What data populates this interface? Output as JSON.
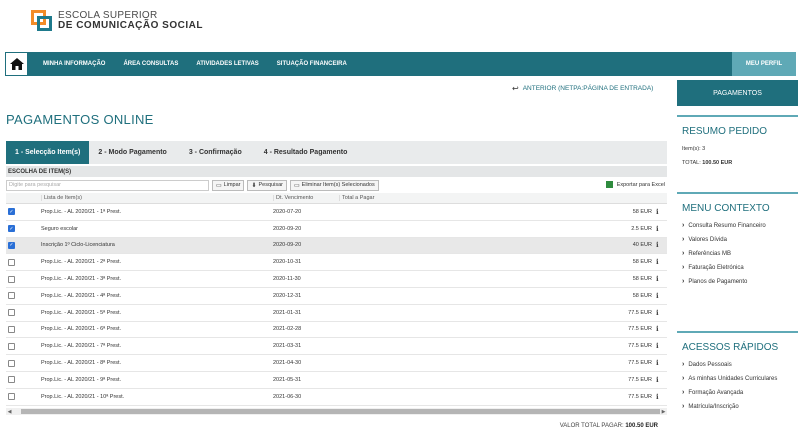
{
  "logo": {
    "line1": "ESCOLA SUPERIOR",
    "line2": "COMUNICAÇÃO SOCIAL",
    "line2_prefix": "DE"
  },
  "nav": {
    "items": [
      "MINHA INFORMAÇÃO",
      "ÁREA CONSULTAS",
      "ATIVIDADES LETIVAS",
      "SITUAÇÃO FINANCEIRA"
    ],
    "profile": "MEU PERFIL"
  },
  "anterior": "ANTERIOR (NETPA:PÁGINA DE ENTRADA)",
  "page_title": "PAGAMENTOS ONLINE",
  "steps": [
    "1 - Selecção Item(s)",
    "2 - Modo Pagamento",
    "3 - Confirmação",
    "4 - Resultado Pagamento"
  ],
  "section_title": "ESCOLHA DE ITEM(S)",
  "toolbar": {
    "search_placeholder": "Digite para pesquisar",
    "clear": "Limpar",
    "search": "Pesquisar",
    "remove": "Eliminar Item(s) Selecionados",
    "export": "Exportar para Excel"
  },
  "table": {
    "headers": {
      "desc": "Lista de Item(s)",
      "date": "Dt. Vencimento",
      "total": "Total a Pagar"
    },
    "rows": [
      {
        "checked": true,
        "desc": "Prop.Lic. - AL 2020/21 - 1ª Prest.",
        "date": "2020-07-20",
        "total": "58 EUR"
      },
      {
        "checked": true,
        "desc": "Seguro escolar",
        "date": "2020-09-20",
        "total": "2.5 EUR"
      },
      {
        "checked": true,
        "desc": "Inscrição 1º Ciclo-Licenciatura",
        "date": "2020-09-20",
        "total": "40 EUR"
      },
      {
        "checked": false,
        "desc": "Prop.Lic. - AL 2020/21 - 2ª Prest.",
        "date": "2020-10-31",
        "total": "58 EUR"
      },
      {
        "checked": false,
        "desc": "Prop.Lic. - AL 2020/21 - 3ª Prest.",
        "date": "2020-11-30",
        "total": "58 EUR"
      },
      {
        "checked": false,
        "desc": "Prop.Lic. - AL 2020/21 - 4ª Prest.",
        "date": "2020-12-31",
        "total": "58 EUR"
      },
      {
        "checked": false,
        "desc": "Prop.Lic. - AL 2020/21 - 5ª Prest.",
        "date": "2021-01-31",
        "total": "77.5 EUR"
      },
      {
        "checked": false,
        "desc": "Prop.Lic. - AL 2020/21 - 6ª Prest.",
        "date": "2021-02-28",
        "total": "77.5 EUR"
      },
      {
        "checked": false,
        "desc": "Prop.Lic. - AL 2020/21 - 7ª Prest.",
        "date": "2021-03-31",
        "total": "77.5 EUR"
      },
      {
        "checked": false,
        "desc": "Prop.Lic. - AL 2020/21 - 8ª Prest.",
        "date": "2021-04-30",
        "total": "77.5 EUR"
      },
      {
        "checked": false,
        "desc": "Prop.Lic. - AL 2020/21 - 9ª Prest.",
        "date": "2021-05-31",
        "total": "77.5 EUR"
      },
      {
        "checked": false,
        "desc": "Prop.Lic. - AL 2020/21 - 10ª Prest.",
        "date": "2021-06-30",
        "total": "77.5 EUR"
      }
    ]
  },
  "total_label": "VALOR TOTAL PAGAR:",
  "total_value": "100.50 EUR",
  "sidebar": {
    "payments_button": "PAGAMENTOS",
    "summary_title": "RESUMO PEDIDO",
    "items_label": "Item(s): 3",
    "total_label": "TOTAL:",
    "total_value": "100.50 EUR",
    "context_title": "MENU CONTEXTO",
    "context_links": [
      "Consulta Resumo Financeiro",
      "Valores Dívida",
      "Referências MB",
      "Faturação Eletrónica",
      "Planos de Pagamento"
    ],
    "quick_title": "ACESSOS RÁPIDOS",
    "quick_links": [
      "Dados Pessoais",
      "As minhas Unidades Curriculares",
      "Formação Avançada",
      "Matrícula/Inscrição"
    ]
  },
  "colors": {
    "primary": "#1f6f7d",
    "accent": "#5fa9b6",
    "logo_orange": "#f28c28",
    "checkbox": "#2a6fd6"
  }
}
